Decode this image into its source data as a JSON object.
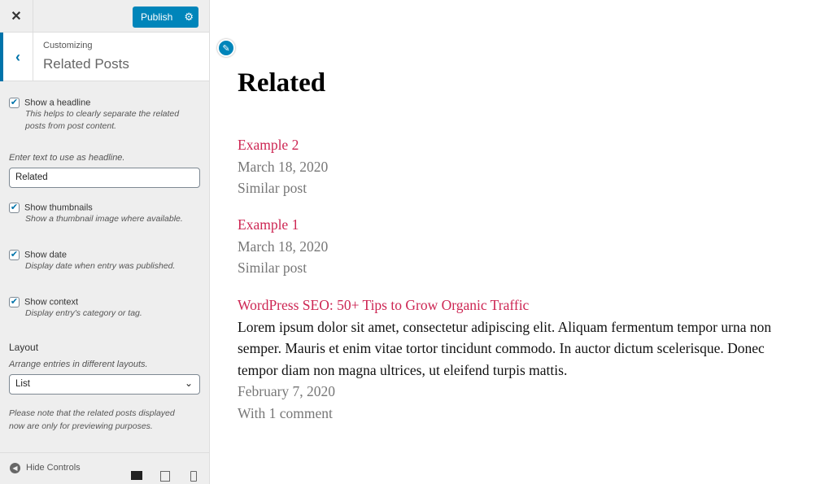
{
  "sidebar": {
    "close_icon": "close-icon",
    "publish": "Publish",
    "subtitle": "Customizing",
    "title": "Related Posts",
    "options": [
      {
        "label": "Show a headline",
        "desc": "This helps to clearly separate the related posts from post content.",
        "checked": true
      },
      {
        "label": "Show thumbnails",
        "desc": "Show a thumbnail image where available.",
        "checked": true
      },
      {
        "label": "Show date",
        "desc": "Display date when entry was published.",
        "checked": true
      },
      {
        "label": "Show context",
        "desc": "Display entry's category or tag.",
        "checked": true
      }
    ],
    "headline_label": "Enter text to use as headline.",
    "headline_value": "Related",
    "layout_title": "Layout",
    "layout_desc": "Arrange entries in different layouts.",
    "layout_value": "List",
    "note": "Please note that the related posts displayed now are only for previewing purposes.",
    "hide_controls": "Hide Controls"
  },
  "preview": {
    "heading": "Related",
    "posts": [
      {
        "title": "Example 2",
        "date": "March 18, 2020",
        "context": "Similar post"
      },
      {
        "title": "Example 1",
        "date": "March 18, 2020",
        "context": "Similar post"
      },
      {
        "title": "WordPress SEO: 50+ Tips to Grow Organic Traffic",
        "excerpt": "Lorem ipsum dolor sit amet, consectetur adipiscing elit. Aliquam fermentum tempor urna non semper. Mauris et enim vitae tortor tincidunt commodo. In auctor dictum scelerisque. Donec tempor diam non magna ultrices, ut eleifend turpis mattis.",
        "date": "February 7, 2020",
        "context": "With 1 comment"
      }
    ]
  },
  "colors": {
    "accent": "#0085ba",
    "link": "#cd2653"
  }
}
